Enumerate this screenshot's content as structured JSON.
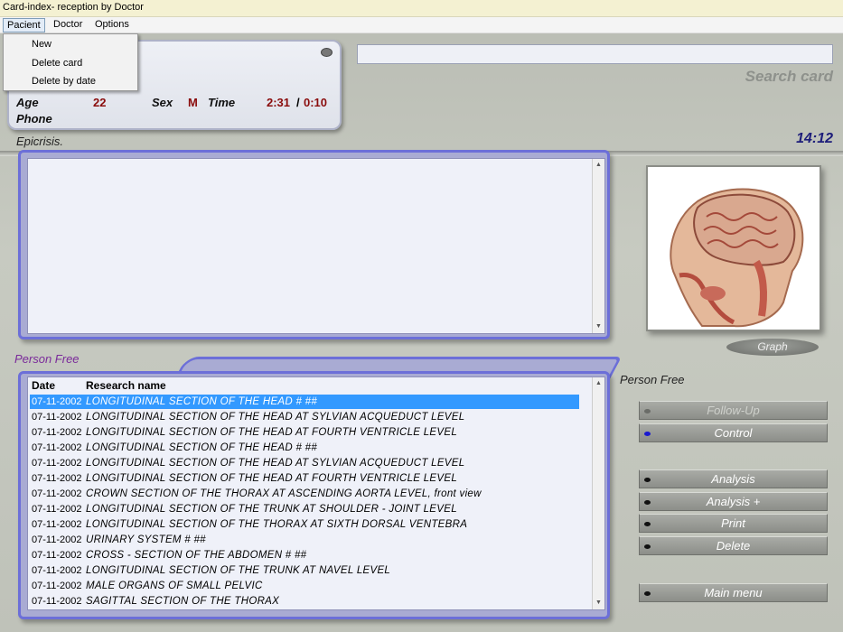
{
  "window": {
    "title": "Card-index- reception by Doctor"
  },
  "menu": {
    "pacient": "Pacient",
    "doctor": "Doctor",
    "options": "Options"
  },
  "pacient_menu": {
    "new": "New",
    "delete_card": "Delete card",
    "delete_by_date": "Delete by date"
  },
  "patient": {
    "age_label": "Age",
    "age": "22",
    "sex_label": "Sex",
    "sex": "M",
    "time_label": "Time",
    "time_1": "2:31",
    "time_sep": "/",
    "time_2": "0:10",
    "phone_label": "Phone"
  },
  "search": {
    "value": "",
    "label": "Search card"
  },
  "epicrisis": {
    "label": "Epicrisis.",
    "text": ""
  },
  "clock": "14:12",
  "person_left": "Person  Free",
  "person_right": "Person  Free",
  "graph_button": "Graph",
  "table": {
    "headers": {
      "date": "Date",
      "name": "Research name"
    },
    "rows": [
      {
        "date": "07-11-2002",
        "name": "LONGITUDINAL  SECTION  OF  THE  HEAD  # ##"
      },
      {
        "date": "07-11-2002",
        "name": "LONGITUDINAL  SECTION  OF  THE  HEAD  AT SYLVIAN  ACQUEDUCT  LEVEL"
      },
      {
        "date": "07-11-2002",
        "name": "LONGITUDINAL  SECTION  OF  THE  HEAD  AT  FOURTH  VENTRICLE  LEVEL"
      },
      {
        "date": "07-11-2002",
        "name": "LONGITUDINAL  SECTION  OF  THE  HEAD  # ##"
      },
      {
        "date": "07-11-2002",
        "name": "LONGITUDINAL  SECTION  OF  THE  HEAD  AT SYLVIAN  ACQUEDUCT  LEVEL"
      },
      {
        "date": "07-11-2002",
        "name": "LONGITUDINAL  SECTION  OF  THE  HEAD  AT FOURTH  VENTRICLE  LEVEL"
      },
      {
        "date": "07-11-2002",
        "name": "CROWN  SECTION  OF  THE  THORAX  AT  ASCENDING  AORTA  LEVEL,  front  view"
      },
      {
        "date": "07-11-2002",
        "name": "LONGITUDINAL  SECTION  OF  THE  TRUNK  AT  SHOULDER - JOINT  LEVEL"
      },
      {
        "date": "07-11-2002",
        "name": "LONGITUDINAL  SECTION  OF  THE  THORAX  AT  SIXTH  DORSAL  VENTEBRA"
      },
      {
        "date": "07-11-2002",
        "name": "URINARY  SYSTEM # ##"
      },
      {
        "date": "07-11-2002",
        "name": "CROSS - SECTION  OF  THE  ABDOMEN  # ##"
      },
      {
        "date": "07-11-2002",
        "name": "LONGITUDINAL  SECTION  OF THE  TRUNK  AT  NAVEL  LEVEL"
      },
      {
        "date": "07-11-2002",
        "name": "MALE  ORGANS  OF  SMALL  PELVIC"
      },
      {
        "date": "07-11-2002",
        "name": "SAGITTAL  SECTION  OF  THE  THORAX"
      }
    ]
  },
  "buttons": {
    "follow_up": "Follow-Up",
    "control": "Control",
    "analysis": "Analysis",
    "analysis_plus": "Analysis  +",
    "print": "Print",
    "delete": "Delete",
    "main_menu": "Main  menu"
  }
}
